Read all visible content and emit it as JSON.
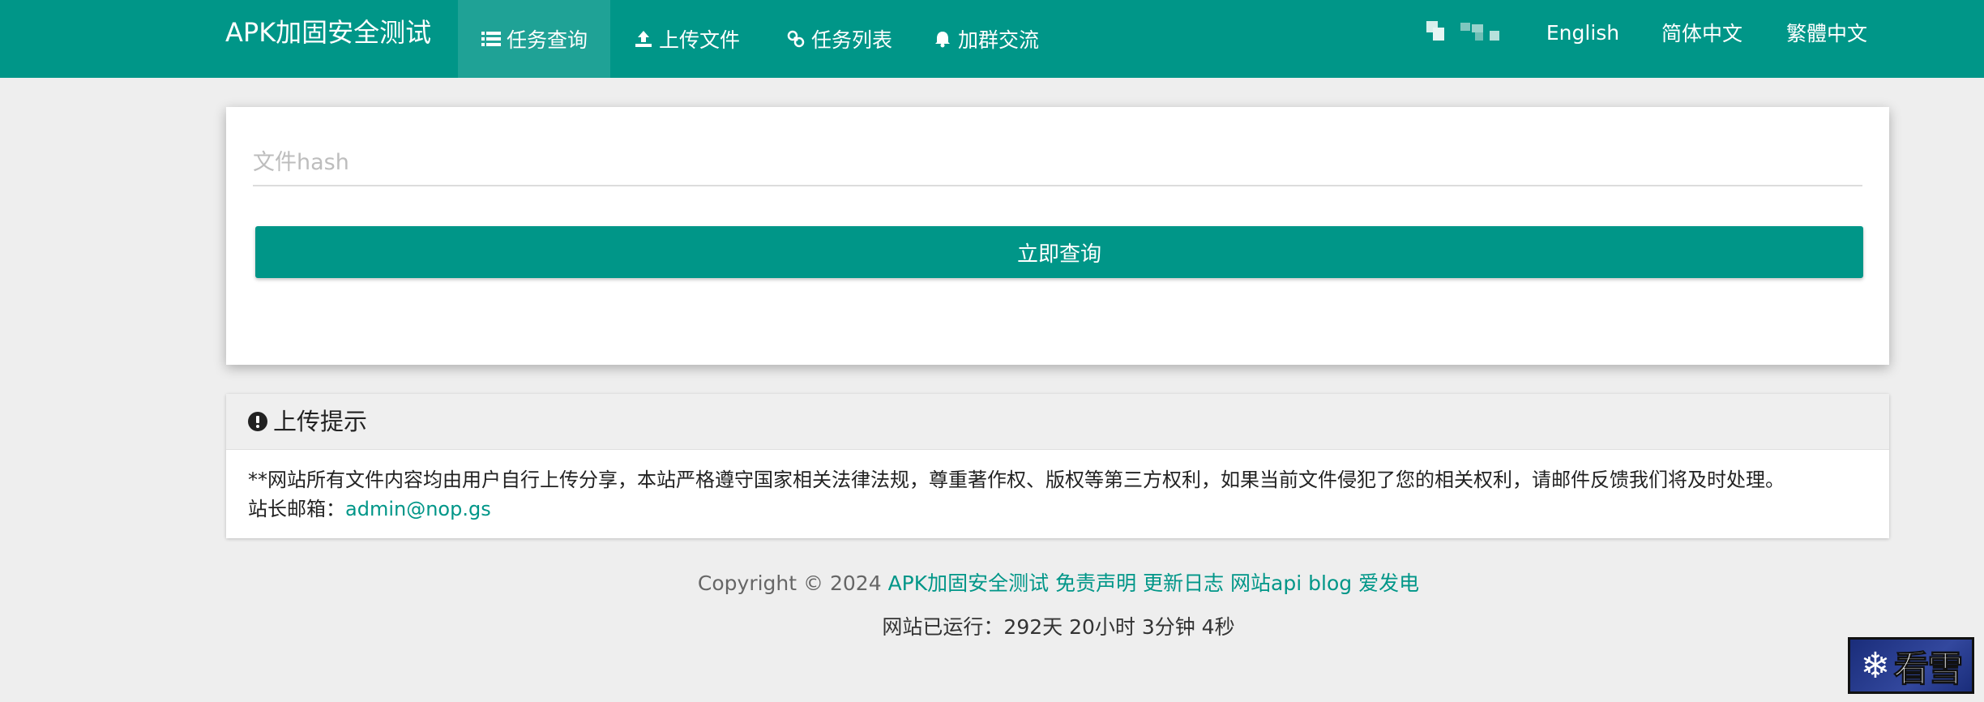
{
  "navbar": {
    "brand": "APK加固安全测试",
    "items": [
      {
        "label": "任务查询",
        "icon": "list-icon",
        "active": true
      },
      {
        "label": "上传文件",
        "icon": "upload-icon",
        "active": false
      },
      {
        "label": "任务列表",
        "icon": "link-icon",
        "active": false
      },
      {
        "label": "加群交流",
        "icon": "bell-icon",
        "active": false
      }
    ],
    "languages": [
      "English",
      "简体中文",
      "繁體中文"
    ],
    "user_avatar": "blurred-avatar"
  },
  "search": {
    "placeholder": "文件hash",
    "value": "",
    "button_label": "立即查询"
  },
  "notice": {
    "icon": "exclamation-circle-icon",
    "title": "上传提示",
    "body": "**网站所有文件内容均由用户自行上传分享，本站严格遵守国家相关法律法规，尊重著作权、版权等第三方权利，如果当前文件侵犯了您的相关权利，请邮件反馈我们将及时处理。",
    "email_label": "站长邮箱：",
    "email": "admin@nop.gs"
  },
  "footer": {
    "copyright": "Copyright © 2024",
    "links": [
      "APK加固安全测试",
      "免责声明",
      "更新日志",
      "网站api",
      "blog",
      "爱发电"
    ],
    "uptime": "网站已运行：292天 20小时 3分钟 4秒"
  },
  "watermark": {
    "text": "看雪"
  },
  "colors": {
    "primary": "#009688",
    "background": "#eeeeee",
    "panel_head": "#efefef"
  }
}
